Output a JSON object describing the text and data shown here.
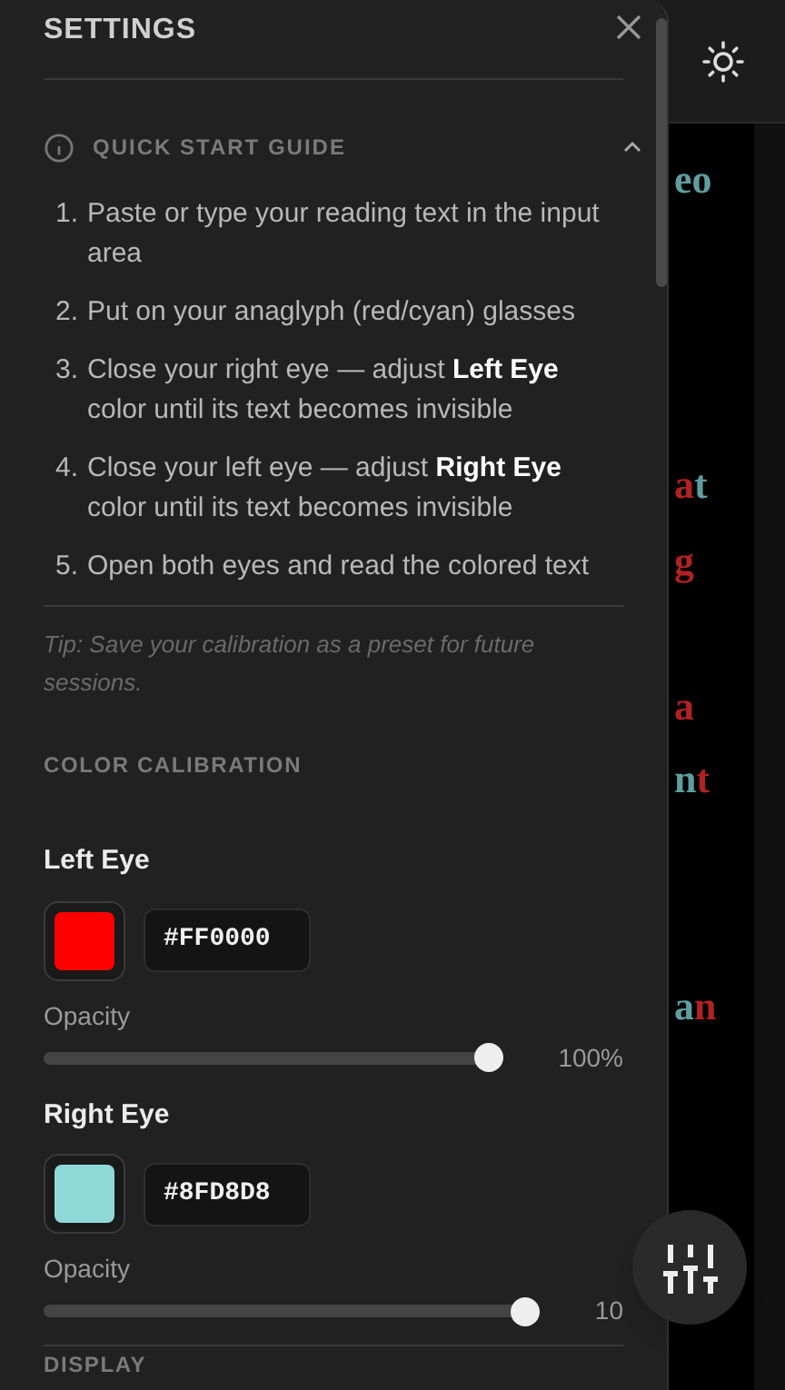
{
  "panel": {
    "title": "SETTINGS",
    "guide": {
      "title": "QUICK START GUIDE",
      "expanded": true,
      "steps": [
        {
          "number": "1.",
          "text": "Paste or type your reading text in the input area"
        },
        {
          "number": "2.",
          "text": "Put on your anaglyph (red/cyan) glasses"
        },
        {
          "number": "3.",
          "text": "Close your right eye — adjust **Left Eye** color until its text becomes invisible"
        },
        {
          "number": "4.",
          "text": "Close your left eye — adjust **Right Eye** color until its text becomes invisible"
        },
        {
          "number": "5.",
          "text": "Open both eyes and read the colored text"
        }
      ],
      "tip": "Tip: Save your calibration as a preset for future sessions."
    },
    "calibration": {
      "title": "COLOR CALIBRATION",
      "eyes": [
        {
          "label": "Left Eye",
          "color": "#ff0000",
          "hex": "#FF0000",
          "opacity_label": "Opacity",
          "level": 1,
          "reading": "100%"
        },
        {
          "label": "Right Eye",
          "color": "#8fd8d8",
          "hex": "#8FD8D8",
          "opacity_label": "Opacity",
          "level": 1,
          "reading": "10"
        }
      ]
    },
    "next_section": "DISPLAY"
  },
  "reading_fragments": [
    [
      {
        "text": "eo",
        "color": "#5f9ea0"
      }
    ],
    [
      {
        "text": "a",
        "color": "#b22222"
      },
      {
        "text": "t",
        "color": "#5f9ea0"
      }
    ],
    [
      {
        "text": "g",
        "color": "#b22222"
      }
    ],
    [
      {
        "text": "a",
        "color": "#b22222"
      }
    ],
    [
      {
        "text": "n",
        "color": "#5f9ea0"
      },
      {
        "text": "t",
        "color": "#b22222"
      }
    ],
    [
      {
        "text": "a",
        "color": "#5f9ea0"
      },
      {
        "text": "n",
        "color": "#b22222"
      }
    ]
  ]
}
